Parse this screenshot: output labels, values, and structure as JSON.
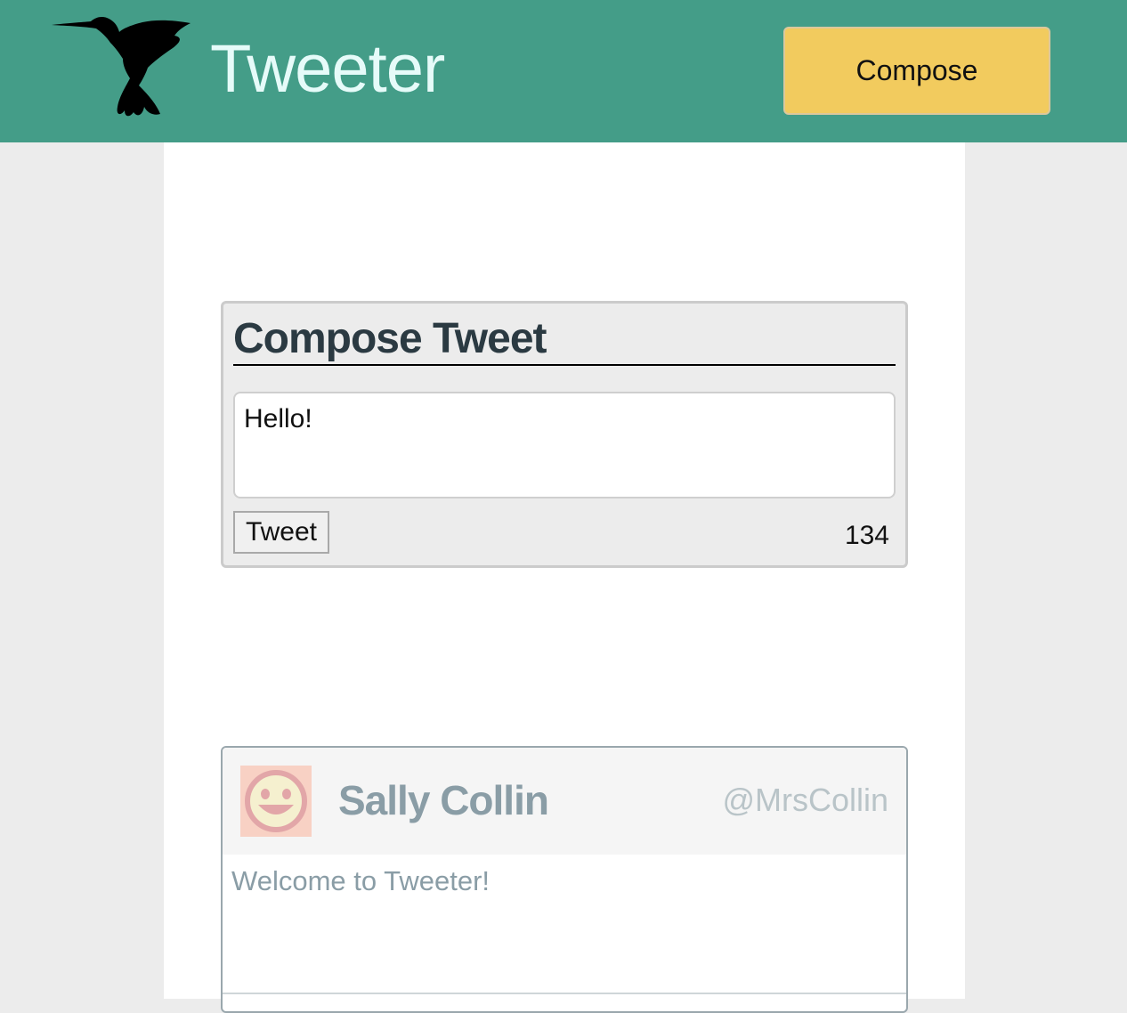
{
  "header": {
    "logo_icon": "hummingbird-icon",
    "title": "Tweeter",
    "compose_button_label": "Compose",
    "background_color": "#449d88",
    "compose_button_color": "#f2cb5e"
  },
  "compose": {
    "heading": "Compose Tweet",
    "textarea_value": "Hello!",
    "submit_label": "Tweet",
    "char_count": "134"
  },
  "tweets": [
    {
      "avatar_icon": "smiley-face-icon",
      "name": "Sally Collin",
      "handle": "@MrsCollin",
      "content": "Welcome to Tweeter!"
    }
  ]
}
